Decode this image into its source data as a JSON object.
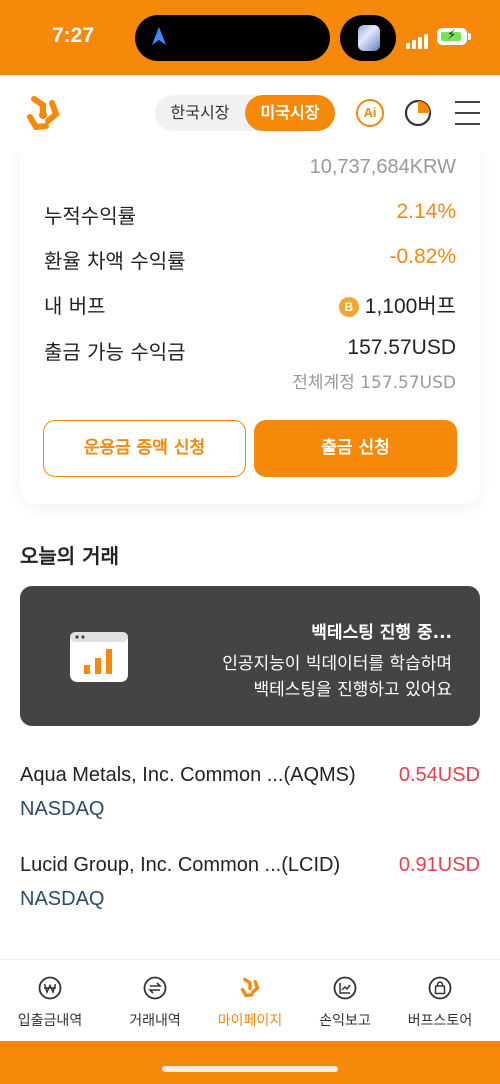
{
  "status_bar": {
    "time": "7:27",
    "brand_color": "#f7890a"
  },
  "header": {
    "market_kr": "한국시장",
    "market_us": "미국시장",
    "selected_market": "미국시장",
    "ai_label": "Ai",
    "icons": [
      "logo-icon",
      "ai-icon",
      "pie-chart-icon",
      "menu-icon"
    ]
  },
  "account": {
    "total_krw": "10,737,684KRW",
    "rows": [
      {
        "label": "누적수익률",
        "value": "2.14%"
      },
      {
        "label": "환율 차액 수익률",
        "value": "-0.82%"
      },
      {
        "label": "내 버프",
        "coin": "B",
        "value": "1,100버프"
      },
      {
        "label": "출금 가능 수익금",
        "value": "157.57USD"
      }
    ],
    "total_account_note": "전체계정 157.57USD",
    "increase_button": "운용금 증액 신청",
    "withdraw_button": "출금 신청"
  },
  "today": {
    "title": "오늘의 거래",
    "backtest": {
      "title": "백테스팅 진행 중...",
      "line1": "인공지능이 빅데이터를 학습하며",
      "line2": "백테스팅을 진행하고 있어요"
    },
    "stocks": [
      {
        "name": "Aqua Metals, Inc. Common ...(AQMS)",
        "price": "0.54USD",
        "exchange": "NASDAQ"
      },
      {
        "name": "Lucid Group, Inc. Common ...(LCID)",
        "price": "0.91USD",
        "exchange": "NASDAQ"
      }
    ]
  },
  "bottom_nav": [
    {
      "label": "입출금내역",
      "icon": "won-coin-icon",
      "active": false
    },
    {
      "label": "거래내역",
      "icon": "exchange-icon",
      "active": false
    },
    {
      "label": "마이페이지",
      "icon": "logo-icon",
      "active": true
    },
    {
      "label": "손익보고",
      "icon": "chart-icon",
      "active": false
    },
    {
      "label": "버프스토어",
      "icon": "shopping-bag-icon",
      "active": false
    }
  ]
}
